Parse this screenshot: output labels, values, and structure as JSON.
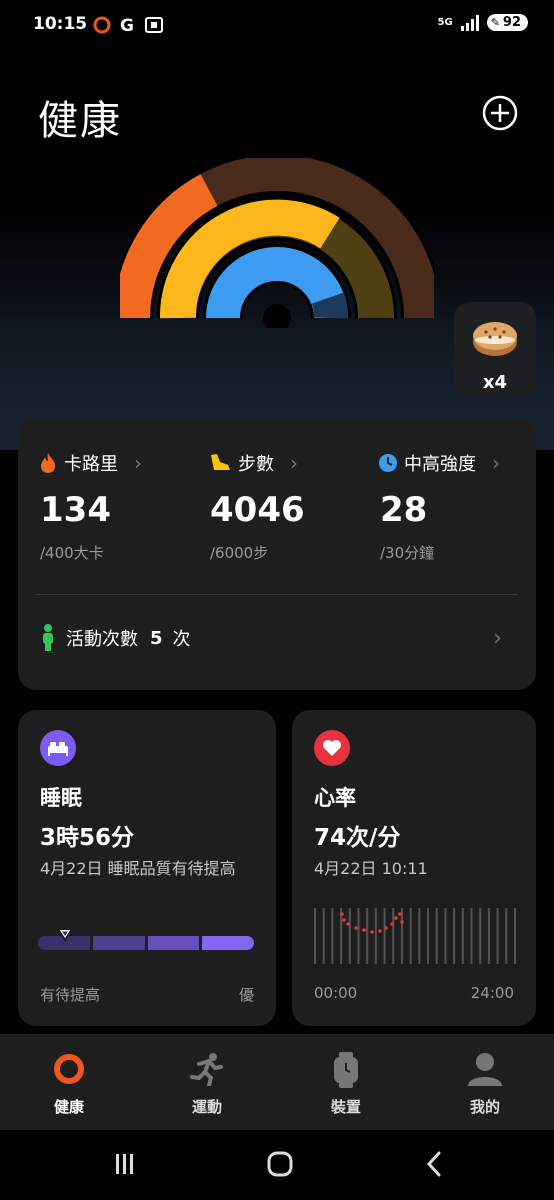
{
  "status": {
    "time": "10:15",
    "network": "5G",
    "battery": "92"
  },
  "header": {
    "title": "健康"
  },
  "reward": {
    "count": "x4"
  },
  "stats": [
    {
      "label": "卡路里",
      "value": "134",
      "target": "/400大卡",
      "color": "#f26a21"
    },
    {
      "label": "步數",
      "value": "4046",
      "target": "/6000步",
      "color": "#ffc107"
    },
    {
      "label": "中高強度",
      "value": "28",
      "target": "/30分鐘",
      "color": "#3d9cf0"
    }
  ],
  "activity": {
    "label": "活動次數",
    "count": "5",
    "unit": "次"
  },
  "sleep": {
    "title": "睡眠",
    "duration": "3時56分",
    "note": "4月22日 睡眠品質有待提高",
    "scale_low": "有待提高",
    "scale_high": "優"
  },
  "heart": {
    "title": "心率",
    "value": "74次/分",
    "time": "4月22日 10:11",
    "x_start": "00:00",
    "x_end": "24:00"
  },
  "nav": [
    {
      "label": "健康",
      "icon": "health-ring-icon",
      "active": true
    },
    {
      "label": "運動",
      "icon": "running-icon",
      "active": false
    },
    {
      "label": "裝置",
      "icon": "watch-icon",
      "active": false
    },
    {
      "label": "我的",
      "icon": "profile-icon",
      "active": false
    }
  ],
  "colors": {
    "calorie": "#f26a21",
    "steps": "#ffc107",
    "intensity": "#3d9cf0",
    "sleep": "#7b5cf0",
    "heart": "#e8323f",
    "active_nav": "#f0561f"
  }
}
